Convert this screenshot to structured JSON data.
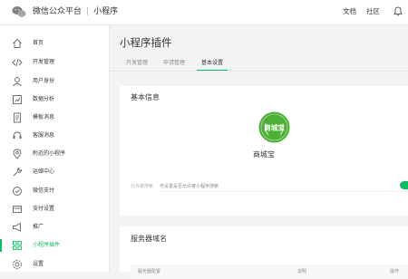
{
  "header": {
    "brand": "微信公众平台",
    "product": "小程序",
    "links": [
      {
        "label": "文档"
      },
      {
        "label": "社区"
      }
    ]
  },
  "sidebar": {
    "items": [
      {
        "label": "首页",
        "icon": "home-icon"
      },
      {
        "label": "开发管理",
        "icon": "code-icon"
      },
      {
        "label": "用户身份",
        "icon": "user-icon"
      },
      {
        "label": "数据分析",
        "icon": "chart-icon"
      },
      {
        "label": "模板消息",
        "icon": "document-icon"
      },
      {
        "label": "客服消息",
        "icon": "customer-service-icon"
      },
      {
        "label": "附近的小程序",
        "icon": "location-icon"
      },
      {
        "label": "运维中心",
        "icon": "wrench-icon"
      },
      {
        "label": "微信支付",
        "icon": "pay-icon"
      },
      {
        "label": "支付设置",
        "icon": "payment-settings-icon"
      },
      {
        "label": "推广",
        "icon": "megaphone-icon"
      },
      {
        "label": "小程序插件",
        "icon": "plugin-icon",
        "active": true
      },
      {
        "label": "设置",
        "icon": "gear-icon"
      }
    ]
  },
  "main": {
    "title": "小程序插件",
    "tabs": [
      {
        "label": "开发管理"
      },
      {
        "label": "申请管理"
      },
      {
        "label": "基本设置",
        "active": true
      }
    ],
    "basic_info": {
      "title": "基本信息",
      "plugin_logo_text": "商城宝",
      "plugin_name": "商城宝",
      "allow_search_label": "允许被搜索",
      "allow_search_desc": "可设置是否允许被小程序搜索",
      "allow_search_enabled": true
    },
    "server_domain": {
      "title": "服务器域名",
      "columns": [
        "服务器配置",
        "说明",
        "操作"
      ]
    }
  },
  "colors": {
    "accent": "#07c160",
    "logo_green": "#4cb035"
  }
}
